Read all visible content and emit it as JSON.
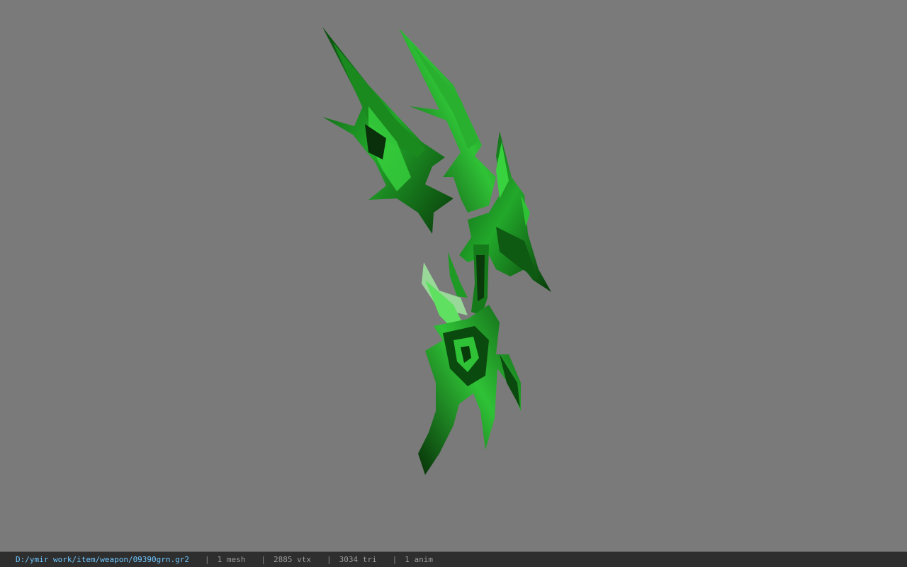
{
  "viewport": {
    "background_color": "#7a7a7a",
    "model_color": "#1f9a24",
    "model_highlight": "#5fe060",
    "model_shadow": "#0a3a0c"
  },
  "status_bar": {
    "path": "D:/ymir work/item/weapon/09390grn.gr2",
    "separator": "|",
    "mesh": "1 mesh",
    "vtx": "2885 vtx",
    "tri": "3034 tri",
    "anim": "1 anim"
  }
}
